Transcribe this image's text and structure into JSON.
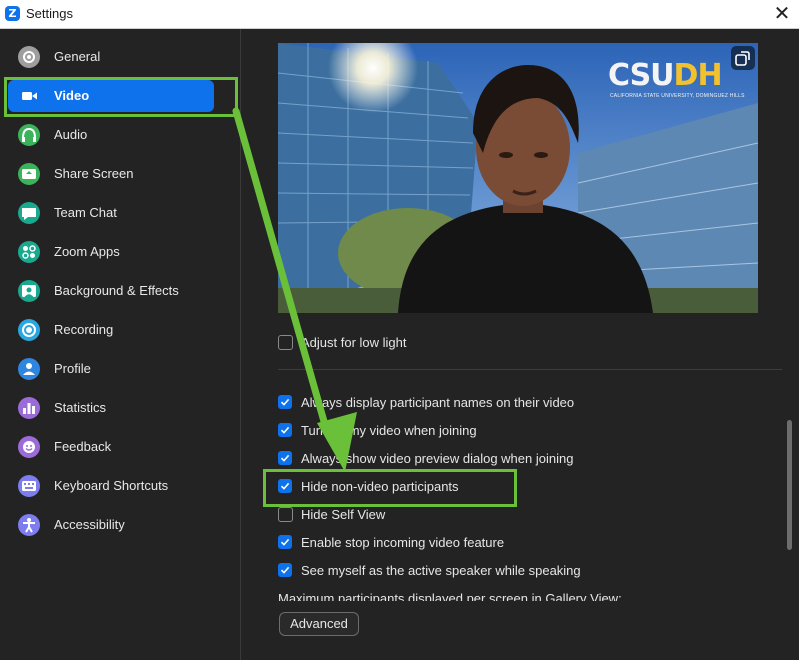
{
  "window": {
    "title": "Settings",
    "logo_letter": "Z",
    "close_glyph": "✕"
  },
  "sidebar": {
    "items": [
      {
        "label": "General",
        "icon": "gear-icon",
        "color": "#9e9e9e",
        "active": false
      },
      {
        "label": "Video",
        "icon": "video-camera-icon",
        "color": "#0e72ed",
        "active": true
      },
      {
        "label": "Audio",
        "icon": "headphones-icon",
        "color": "#3bb35a",
        "active": false
      },
      {
        "label": "Share Screen",
        "icon": "share-screen-icon",
        "color": "#3bb35a",
        "active": false
      },
      {
        "label": "Team Chat",
        "icon": "chat-bubble-icon",
        "color": "#19a98f",
        "active": false
      },
      {
        "label": "Zoom Apps",
        "icon": "apps-icon",
        "color": "#19a98f",
        "active": false
      },
      {
        "label": "Background & Effects",
        "icon": "person-background-icon",
        "color": "#19a98f",
        "active": false
      },
      {
        "label": "Recording",
        "icon": "record-icon",
        "color": "#2aa6e0",
        "active": false
      },
      {
        "label": "Profile",
        "icon": "profile-icon",
        "color": "#2f86e0",
        "active": false
      },
      {
        "label": "Statistics",
        "icon": "statistics-icon",
        "color": "#9b6cd9",
        "active": false
      },
      {
        "label": "Feedback",
        "icon": "smiley-feedback-icon",
        "color": "#9b6cd9",
        "active": false
      },
      {
        "label": "Keyboard Shortcuts",
        "icon": "keyboard-icon",
        "color": "#7d7df0",
        "active": false
      },
      {
        "label": "Accessibility",
        "icon": "accessibility-icon",
        "color": "#7d7df0",
        "active": false
      }
    ]
  },
  "preview": {
    "brand_main": "CSU",
    "brand_accent": "DH",
    "brand_sub": "CALIFORNIA STATE UNIVERSITY, DOMINGUEZ HILLS",
    "rotate_icon": "rotate-camera-icon"
  },
  "options": {
    "low_light": {
      "label": "Adjust for low light",
      "checked": false
    },
    "items": [
      {
        "label": "Always display participant names on their video",
        "checked": true
      },
      {
        "label": "Turn off my video when joining",
        "checked": true
      },
      {
        "label": "Always show video preview dialog when joining",
        "checked": true
      },
      {
        "label": "Hide non-video participants",
        "checked": true
      },
      {
        "label": "Hide Self View",
        "checked": false
      },
      {
        "label": "Enable stop incoming video feature",
        "checked": true
      },
      {
        "label": "See myself as the active speaker while speaking",
        "checked": true
      }
    ],
    "gallery_text": "Maximum participants displayed per screen in Gallery View:"
  },
  "advanced_button": "Advanced",
  "annotation": {
    "color": "#6ac139"
  },
  "colors": {
    "accent": "#0e72ed",
    "background": "#232323",
    "text": "#e6e6e6"
  }
}
